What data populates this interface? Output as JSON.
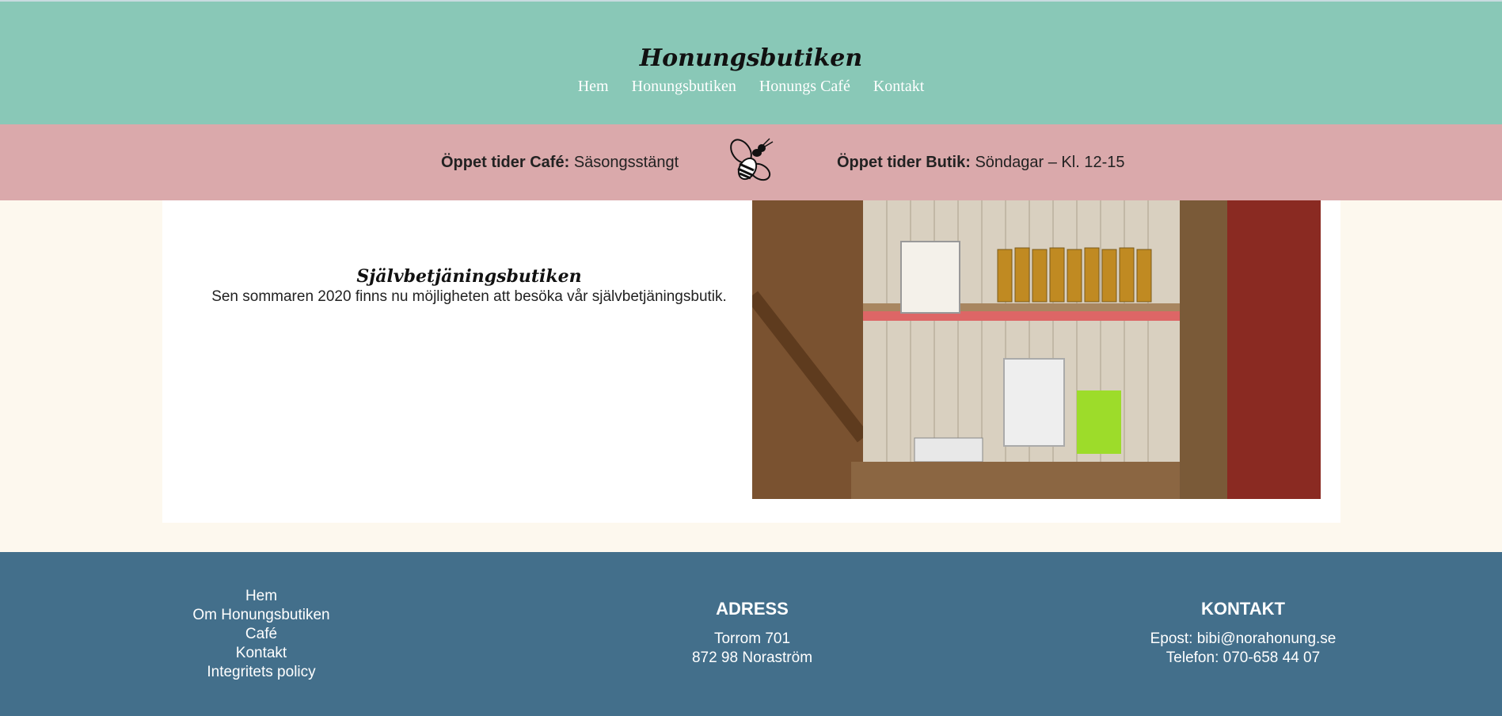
{
  "header": {
    "title": "Honungsbutiken",
    "nav": [
      "Hem",
      "Honungsbutiken",
      "Honungs Café",
      "Kontakt"
    ]
  },
  "hours": {
    "cafe_label": "Öppet tider Café:",
    "cafe_value": "Säsongsstängt",
    "shop_label": "Öppet tider Butik:",
    "shop_value": "Söndagar – Kl. 12-15"
  },
  "main": {
    "title": "Självbetjäningsbutiken",
    "text": "Sen sommaren 2020 finns nu möjligheten att besöka vår självbetjäningsbutik."
  },
  "footer": {
    "links": [
      "Hem",
      "Om Honungsbutiken",
      "Café",
      "Kontakt",
      "Integritets policy"
    ],
    "address_heading": "ADRESS",
    "address_line1": "Torrom 701",
    "address_line2": "872 98 Noraström",
    "contact_heading": "KONTAKT",
    "email": "Epost: bibi@norahonung.se",
    "phone": "Telefon: 070-658 44 07"
  },
  "colors": {
    "header_bg": "#89c8b7",
    "hours_bg": "#daa9ab",
    "page_bg": "#fdf8ee",
    "footer_bg": "#436f8b"
  },
  "icons": {
    "hours_divider": "bee-icon"
  }
}
